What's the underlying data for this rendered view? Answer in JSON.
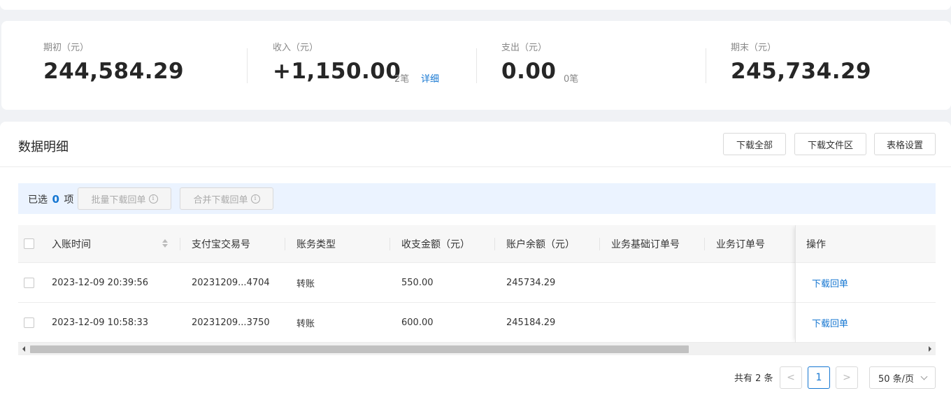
{
  "summary": {
    "opening": {
      "label": "期初（元）",
      "value": "244,584.29"
    },
    "income": {
      "label": "收入（元）",
      "value": "+1,150.00",
      "count": "2笔",
      "detail_link": "详细"
    },
    "expense": {
      "label": "支出（元）",
      "value": "0.00",
      "count": "0笔"
    },
    "closing": {
      "label": "期末（元）",
      "value": "245,734.29"
    }
  },
  "detail": {
    "title": "数据明细",
    "buttons": {
      "download_all": "下载全部",
      "download_files": "下载文件区",
      "table_settings": "表格设置"
    }
  },
  "selection": {
    "prefix": "已选",
    "count": "0",
    "suffix": "项",
    "batch_download": "批量下载回单",
    "merge_download": "合并下载回单",
    "info_icon": "i"
  },
  "table": {
    "columns": [
      "入账时间",
      "支付宝交易号",
      "账务类型",
      "收支金额（元）",
      "账户余额（元）",
      "业务基础订单号",
      "业务订单号",
      "操作"
    ],
    "rows": [
      {
        "time": "2023-12-09 20:39:56",
        "trade_no": "20231209...4704",
        "type": "转账",
        "amount": "550.00",
        "balance": "245734.29",
        "base_order": "",
        "order": "",
        "action": "下载回单"
      },
      {
        "time": "2023-12-09 10:58:33",
        "trade_no": "20231209...3750",
        "type": "转账",
        "amount": "600.00",
        "balance": "245184.29",
        "base_order": "",
        "order": "",
        "action": "下载回单"
      }
    ]
  },
  "pagination": {
    "total": "共有 2 条",
    "prev": "<",
    "current": "1",
    "next": ">",
    "page_size": "50 条/页"
  },
  "colors": {
    "accent": "#1677d2",
    "selection_bg": "#ebf3ff"
  }
}
